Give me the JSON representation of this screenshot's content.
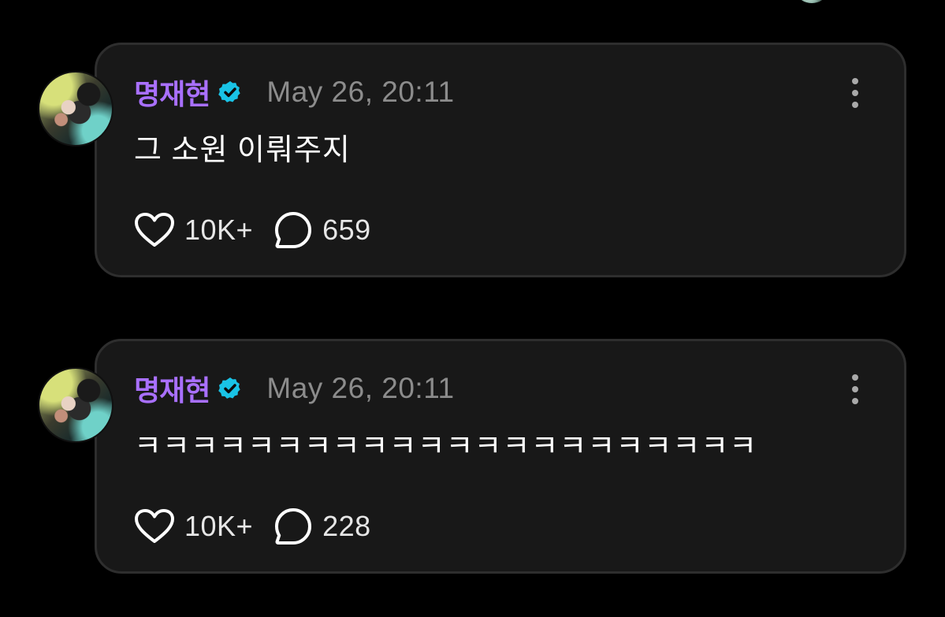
{
  "posts": [
    {
      "author": "명재현",
      "timestamp": "May 26, 20:11",
      "text": "그 소원 이뤄주지",
      "likes": "10K+",
      "comments": "659"
    },
    {
      "author": "명재현",
      "timestamp": "May 26, 20:11",
      "text": "ㅋㅋㅋㅋㅋㅋㅋㅋㅋㅋㅋㅋㅋㅋㅋㅋㅋㅋㅋㅋㅋㅋ",
      "likes": "10K+",
      "comments": "228"
    }
  ],
  "icons": {
    "verified": "verified-badge-icon",
    "like": "heart-icon",
    "comment": "chat-bubble-icon",
    "more": "more-vertical-icon"
  },
  "colors": {
    "background": "#000000",
    "card": "#181818",
    "username": "#a970ff",
    "verified": "#19c3e6",
    "timestamp": "#8c8c8c"
  }
}
